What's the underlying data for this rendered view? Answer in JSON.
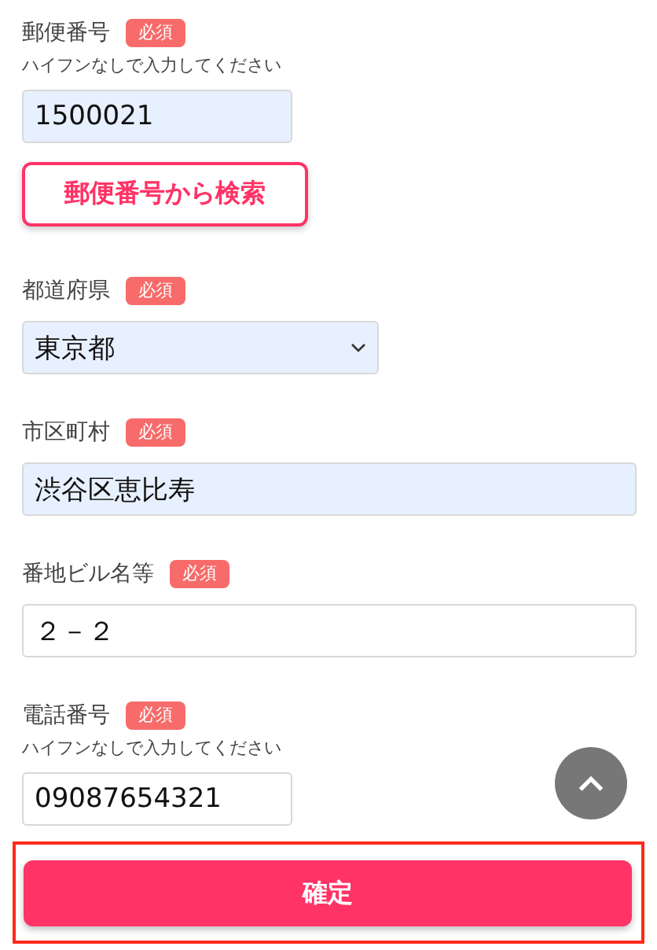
{
  "fields": [
    {
      "label": "郵便番号",
      "badge": "必須",
      "hint": "ハイフンなしで入力してください",
      "kind": "short",
      "value": "1500021",
      "autofilled": true,
      "action": "郵便番号から検索"
    },
    {
      "label": "都道府県",
      "badge": "必須",
      "kind": "select",
      "value": "東京都",
      "autofilled": true
    },
    {
      "label": "市区町村",
      "badge": "必須",
      "kind": "long",
      "value": "渋谷区恵比寿",
      "autofilled": true
    },
    {
      "label": "番地ビル名等",
      "badge": "必須",
      "kind": "long",
      "value": "２－２",
      "autofilled": false
    },
    {
      "label": "電話番号",
      "badge": "必須",
      "hint": "ハイフンなしで入力してください",
      "kind": "short",
      "value": "09087654321",
      "autofilled": false
    }
  ],
  "submit": {
    "label": "確定",
    "highlighted": true
  }
}
